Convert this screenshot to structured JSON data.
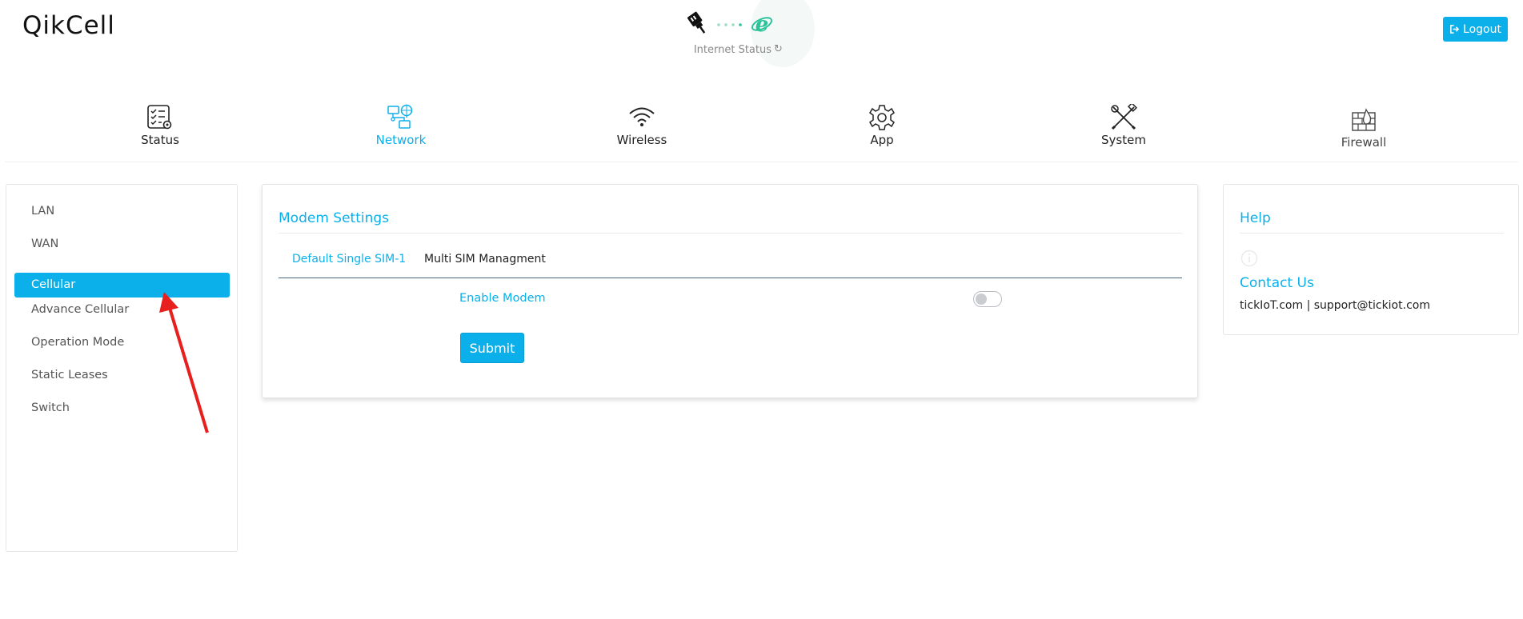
{
  "app": {
    "logo_text": "QikCell"
  },
  "internet_status": {
    "label": "Internet Status",
    "refresh_icon": "refresh-icon",
    "accent": "#2bc39a"
  },
  "header": {
    "logout_label": "Logout",
    "logout_icon": "sign-out-icon"
  },
  "main_nav": {
    "items": [
      {
        "label": "Status",
        "icon": "checklist-gear-icon"
      },
      {
        "label": "Network",
        "icon": "network-devices-icon",
        "active": true
      },
      {
        "label": "Wireless",
        "icon": "wifi-icon"
      },
      {
        "label": "App",
        "icon": "gear-icon"
      },
      {
        "label": "System",
        "icon": "tools-icon"
      },
      {
        "label": "Firewall",
        "icon": "firewall-icon"
      }
    ]
  },
  "sidebar": {
    "items": [
      {
        "label": "LAN"
      },
      {
        "label": "WAN"
      },
      {
        "label": "Cellular",
        "active": true
      },
      {
        "label": "Advance Cellular"
      },
      {
        "label": "Operation Mode"
      },
      {
        "label": "Static Leases"
      },
      {
        "label": "Switch"
      }
    ]
  },
  "modem_settings": {
    "title": "Modem Settings",
    "tabs": [
      {
        "label": "Default Single SIM-1",
        "active": true
      },
      {
        "label": "Multi SIM Managment"
      }
    ],
    "enable_modem_label": "Enable Modem",
    "enable_modem_on": false,
    "submit_label": "Submit"
  },
  "help": {
    "title": "Help",
    "contact_title": "Contact Us",
    "contact_text": "tickIoT.com | support@tickiot.com"
  },
  "colors": {
    "accent": "#0bb0ea",
    "annotation_arrow": "#e8201d"
  }
}
